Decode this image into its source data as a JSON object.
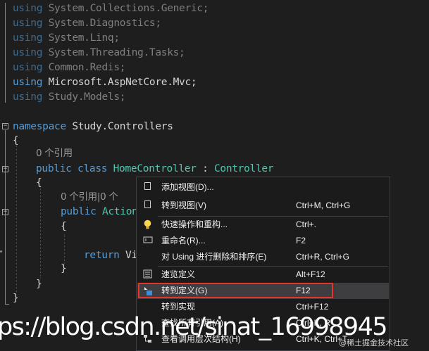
{
  "code": {
    "usings": [
      {
        "kw": "using",
        "ns": "System.Collections.Generic;",
        "active": false
      },
      {
        "kw": "using",
        "ns": "System.Diagnostics;",
        "active": false
      },
      {
        "kw": "using",
        "ns": "System.Linq;",
        "active": false
      },
      {
        "kw": "using",
        "ns": "System.Threading.Tasks;",
        "active": false
      },
      {
        "kw": "using",
        "ns": "Common.Redis;",
        "active": false
      },
      {
        "kw": "using",
        "ns": "Microsoft.AspNetCore.Mvc;",
        "active": true
      },
      {
        "kw": "using",
        "ns": "Study.Models;",
        "active": false
      }
    ],
    "namespace_kw": "namespace",
    "namespace_name": "Study.Controllers",
    "open_brace": "{",
    "close_brace": "}",
    "class_refs": "0 个引用",
    "class_public": "public",
    "class_kw": "class",
    "class_name": "HomeController",
    "class_colon": " : ",
    "class_base": "Controller",
    "method_refs": "0 个引用|0 个",
    "method_public": "public",
    "method_type": "Action",
    "return_kw": "return",
    "return_rest": "Vi"
  },
  "context_menu": {
    "items": [
      {
        "icon": "view-add-icon",
        "label": "添加视图(D)...",
        "shortcut": ""
      },
      {
        "icon": "view-goto-icon",
        "label": "转到视图(V)",
        "shortcut": "Ctrl+M, Ctrl+G"
      },
      {
        "icon": "lightbulb-icon",
        "label": "快速操作和重构...",
        "shortcut": "Ctrl+."
      },
      {
        "icon": "rename-icon",
        "label": "重命名(R)...",
        "shortcut": "F2"
      },
      {
        "icon": "",
        "label": "对 Using 进行删除和排序(E)",
        "shortcut": "Ctrl+R, Ctrl+G"
      },
      {
        "icon": "peek-icon",
        "label": "速览定义",
        "shortcut": "Alt+F12"
      },
      {
        "icon": "goto-definition-icon",
        "label": "转到定义(G)",
        "shortcut": "F12"
      },
      {
        "icon": "",
        "label": "转到实现",
        "shortcut": "Ctrl+F12"
      },
      {
        "icon": "",
        "label": "查找所有引用(A)",
        "shortcut": "Ctrl+K, R"
      },
      {
        "icon": "call-hierarchy-icon",
        "label": "查看调用层次结构(H)",
        "shortcut": "Ctrl+K, Ctrl+T"
      }
    ]
  },
  "watermark": {
    "url": "ps://blog.csdn.net/sinat_16998945",
    "site": "@稀土掘金技术社区"
  },
  "colors": {
    "background": "#1e1e1e",
    "keyword": "#569cd6",
    "type": "#4ec9b0",
    "highlight_box": "#e0362c"
  }
}
